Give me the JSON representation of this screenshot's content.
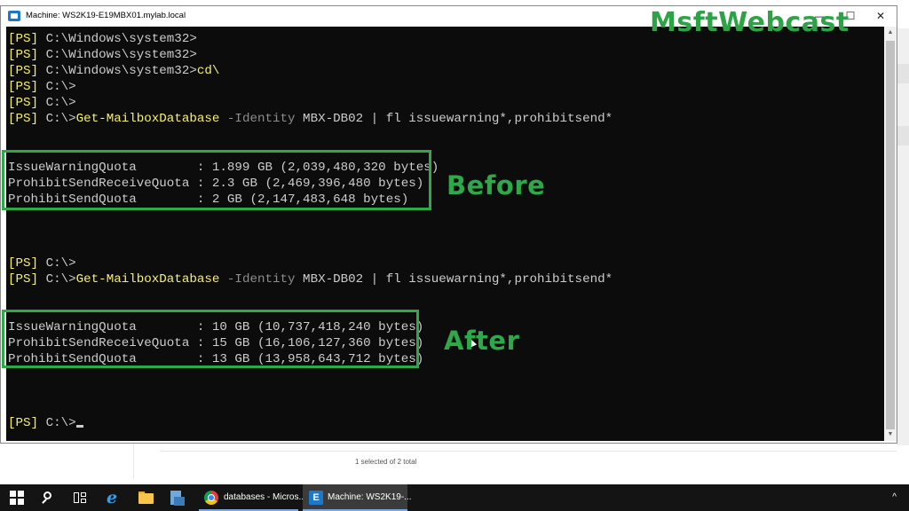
{
  "window": {
    "title": "Machine: WS2K19-E19MBX01.mylab.local",
    "minimize_glyph": "—",
    "maximize_glyph": "☐",
    "close_glyph": "✕"
  },
  "watermark": "MsftWebcast",
  "console": {
    "lines": [
      {
        "prompt": "[PS]",
        "path": " C:\\Windows\\system32>",
        "cmd": "",
        "rest": []
      },
      {
        "prompt": "[PS]",
        "path": " C:\\Windows\\system32>",
        "cmd": "",
        "rest": []
      },
      {
        "prompt": "[PS]",
        "path": " C:\\Windows\\system32>",
        "cmd": "cd\\",
        "rest": []
      },
      {
        "prompt": "[PS]",
        "path": " C:\\>",
        "cmd": "",
        "rest": []
      },
      {
        "prompt": "[PS]",
        "path": " C:\\>",
        "cmd": "",
        "rest": []
      },
      {
        "prompt": "[PS]",
        "path": " C:\\>",
        "cmd": "Get-MailboxDatabase",
        "param": " -Identity",
        "arg": " MBX-DB02 | fl issuewarning*,prohibitsend*"
      }
    ],
    "before": [
      "IssueWarningQuota        : 1.899 GB (2,039,480,320 bytes)",
      "ProhibitSendReceiveQuota : 2.3 GB (2,469,396,480 bytes)",
      "ProhibitSendQuota        : 2 GB (2,147,483,648 bytes)"
    ],
    "lines2": [
      {
        "prompt": "[PS]",
        "path": " C:\\>",
        "cmd": ""
      },
      {
        "prompt": "[PS]",
        "path": " C:\\>",
        "cmd": "Get-MailboxDatabase",
        "param": " -Identity",
        "arg": " MBX-DB02 | fl issuewarning*,prohibitsend*"
      }
    ],
    "after": [
      "IssueWarningQuota        : 10 GB (10,737,418,240 bytes)",
      "ProhibitSendReceiveQuota : 15 GB (16,106,127,360 bytes)",
      "ProhibitSendQuota        : 13 GB (13,958,643,712 bytes)"
    ],
    "final_prompt": {
      "prompt": "[PS]",
      "path": " C:\\>"
    }
  },
  "annotations": {
    "before_label": "Before",
    "after_label": "After"
  },
  "background_app": {
    "status_text": "1 selected of 2 total"
  },
  "taskbar": {
    "chrome_label": "databases - Micros...",
    "console_label": "Machine: WS2K19-...",
    "tray_arrow": "^",
    "ie_glyph": "e",
    "exchange_glyph": "E"
  },
  "colors": {
    "highlight": "#2fa84a",
    "prompt": "#f7f06b",
    "console_bg": "#0c0c0c"
  }
}
